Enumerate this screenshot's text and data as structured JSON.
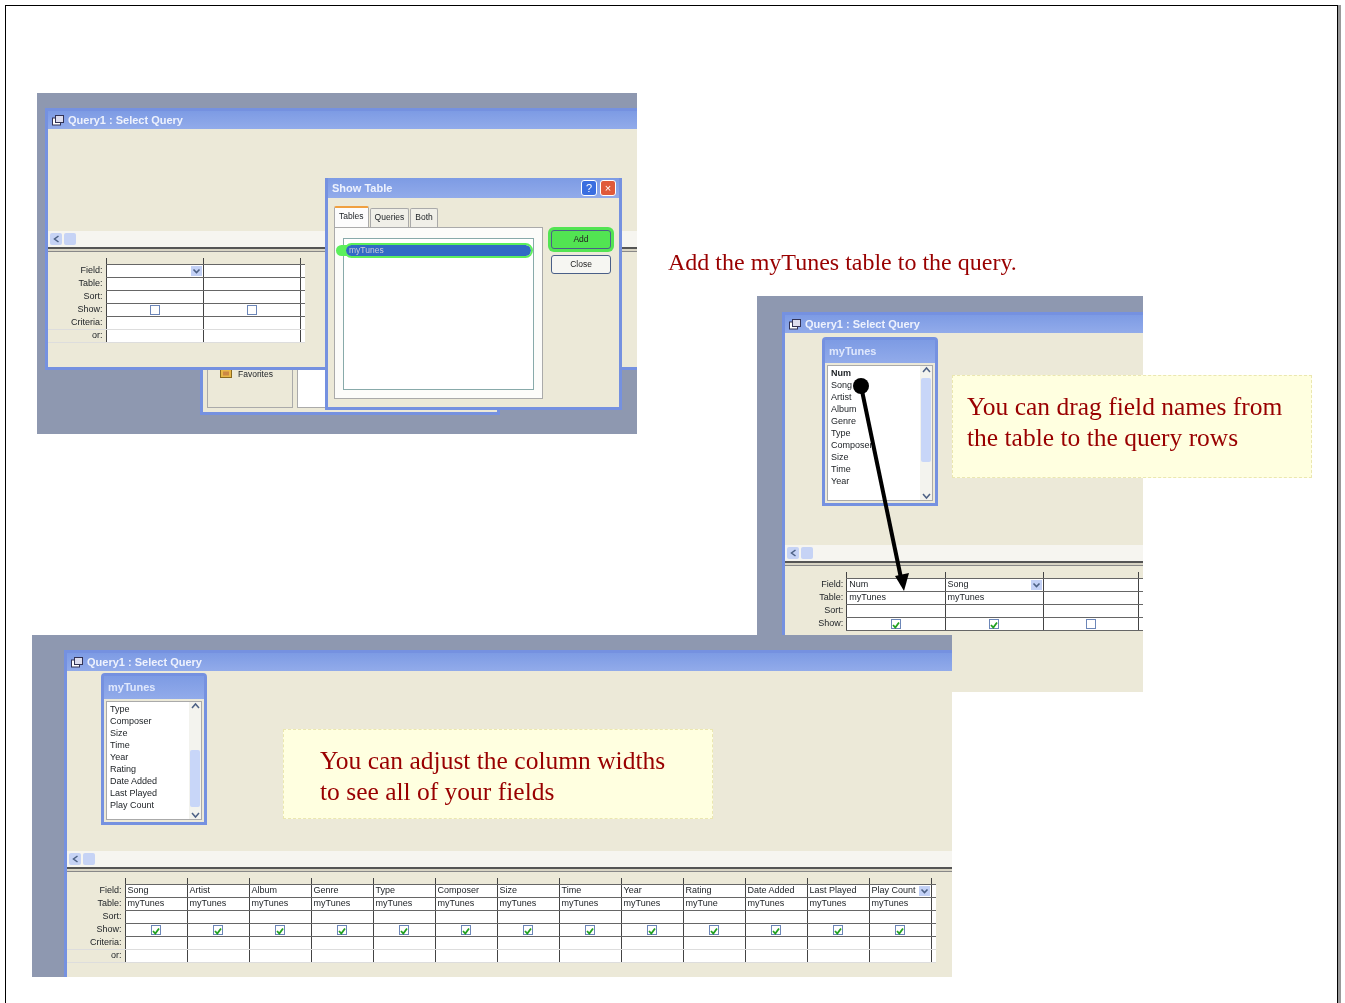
{
  "caption": "Add the myTunes table to the query.",
  "screenshots": [
    {
      "kind": "show_table",
      "window_title": "Query1 : Select Query",
      "grid": {
        "row_labels": [
          "Field:",
          "Table:",
          "Sort:",
          "Show:",
          "Criteria:",
          "or:"
        ],
        "columns": [
          {
            "show": false,
            "dropdown": true
          },
          {
            "show": false,
            "dropdown": false
          }
        ]
      },
      "behind_window": {
        "label": "Favorites"
      },
      "dialog": {
        "title": "Show Table",
        "title_buttons": [
          "?",
          "×"
        ],
        "tabs": [
          {
            "label": "Tables",
            "selected": true
          },
          {
            "label": "Queries",
            "selected": false
          },
          {
            "label": "Both",
            "selected": false
          }
        ],
        "items": [
          {
            "label": "myTunes",
            "selected": true,
            "highlighted": true
          }
        ],
        "buttons": [
          {
            "label": "Add",
            "highlighted": true
          },
          {
            "label": "Close",
            "highlighted": false
          }
        ]
      }
    },
    {
      "kind": "drag",
      "window_title": "Query1 : Select Query",
      "table_box": {
        "title": "myTunes",
        "fields": [
          {
            "label": "Num",
            "bold": true
          },
          {
            "label": "Song",
            "bold": false
          },
          {
            "label": "Artist",
            "bold": false
          },
          {
            "label": "Album",
            "bold": false
          },
          {
            "label": "Genre",
            "bold": false
          },
          {
            "label": "Type",
            "bold": false
          },
          {
            "label": "Composer",
            "bold": false
          },
          {
            "label": "Size",
            "bold": false
          },
          {
            "label": "Time",
            "bold": false
          },
          {
            "label": "Year",
            "bold": false
          }
        ]
      },
      "grid": {
        "row_labels": [
          "Field:",
          "Table:",
          "Sort:",
          "Show:"
        ],
        "columns": [
          {
            "field": "Num",
            "table": "myTunes",
            "show": true,
            "dropdown": false
          },
          {
            "field": "Song",
            "table": "myTunes",
            "show": true,
            "dropdown": true
          },
          {
            "show": false,
            "dropdown": false
          }
        ]
      }
    },
    {
      "kind": "widths",
      "window_title": "Query1 : Select Query",
      "table_box": {
        "title": "myTunes",
        "fields": [
          {
            "label": "Type",
            "bold": false
          },
          {
            "label": "Composer",
            "bold": false
          },
          {
            "label": "Size",
            "bold": false
          },
          {
            "label": "Time",
            "bold": false
          },
          {
            "label": "Year",
            "bold": false
          },
          {
            "label": "Rating",
            "bold": false
          },
          {
            "label": "Date Added",
            "bold": false
          },
          {
            "label": "Last Played",
            "bold": false
          },
          {
            "label": "Play Count",
            "bold": false
          }
        ]
      },
      "grid": {
        "row_labels": [
          "Field:",
          "Table:",
          "Sort:",
          "Show:",
          "Criteria:",
          "or:"
        ],
        "columns": [
          {
            "field": "Song",
            "table": "myTunes",
            "show": true,
            "dropdown": false
          },
          {
            "field": "Artist",
            "table": "myTunes",
            "show": true,
            "dropdown": false
          },
          {
            "field": "Album",
            "table": "myTunes",
            "show": true,
            "dropdown": false
          },
          {
            "field": "Genre",
            "table": "myTunes",
            "show": true,
            "dropdown": false
          },
          {
            "field": "Type",
            "table": "myTunes",
            "show": true,
            "dropdown": false
          },
          {
            "field": "Composer",
            "table": "myTunes",
            "show": true,
            "dropdown": false
          },
          {
            "field": "Size",
            "table": "myTunes",
            "show": true,
            "dropdown": false
          },
          {
            "field": "Time",
            "table": "myTunes",
            "show": true,
            "dropdown": false
          },
          {
            "field": "Year",
            "table": "myTunes",
            "show": true,
            "dropdown": false
          },
          {
            "field": "Rating",
            "table": "myTune",
            "show": true,
            "dropdown": false
          },
          {
            "field": "Date Added",
            "table": "myTunes",
            "show": true,
            "dropdown": false
          },
          {
            "field": "Last Played",
            "table": "myTunes",
            "show": true,
            "dropdown": false
          },
          {
            "field": "Play Count",
            "table": "myTunes",
            "show": true,
            "dropdown": true
          }
        ]
      }
    }
  ],
  "notes": [
    {
      "text": "You can drag field names from the table to the query rows"
    },
    {
      "text": "You can adjust the column widths to see all of your fields"
    }
  ]
}
